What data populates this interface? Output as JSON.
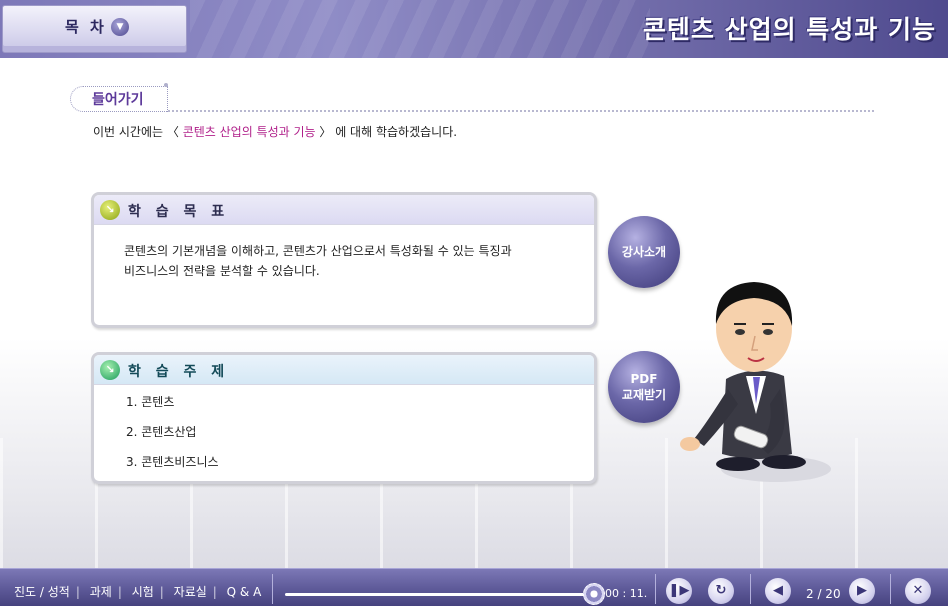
{
  "header": {
    "toc_label": "목 차",
    "title": "콘텐츠 산업의 특성과 기능"
  },
  "intro": {
    "label": "들어가기",
    "text_before": "이번 시간에는 〈 ",
    "text_highlight": "콘텐츠 산업의 특성과 기능",
    "text_after": " 〉 에 대해 학습하겠습니다."
  },
  "objectives": {
    "title": "학 습 목 표",
    "line1": "콘텐츠의 기본개념을 이해하고, 콘텐츠가 산업으로서 특성화될 수 있는 특징과",
    "line2": "비즈니스의 전략을 분석할 수 있습니다."
  },
  "topics": {
    "title": "학 습 주 제",
    "items": [
      "1. 콘텐츠",
      "2. 콘텐츠산업",
      "3. 콘텐츠비즈니스"
    ]
  },
  "side_buttons": {
    "lecturer": "강사소개",
    "pdf_line1": "PDF",
    "pdf_line2": "교재받기"
  },
  "footer": {
    "nav": [
      "진도 / 성적",
      "과제",
      "시험",
      "자료실",
      "Q & A"
    ],
    "time": "00 : 11.",
    "page": "2 / 20"
  }
}
